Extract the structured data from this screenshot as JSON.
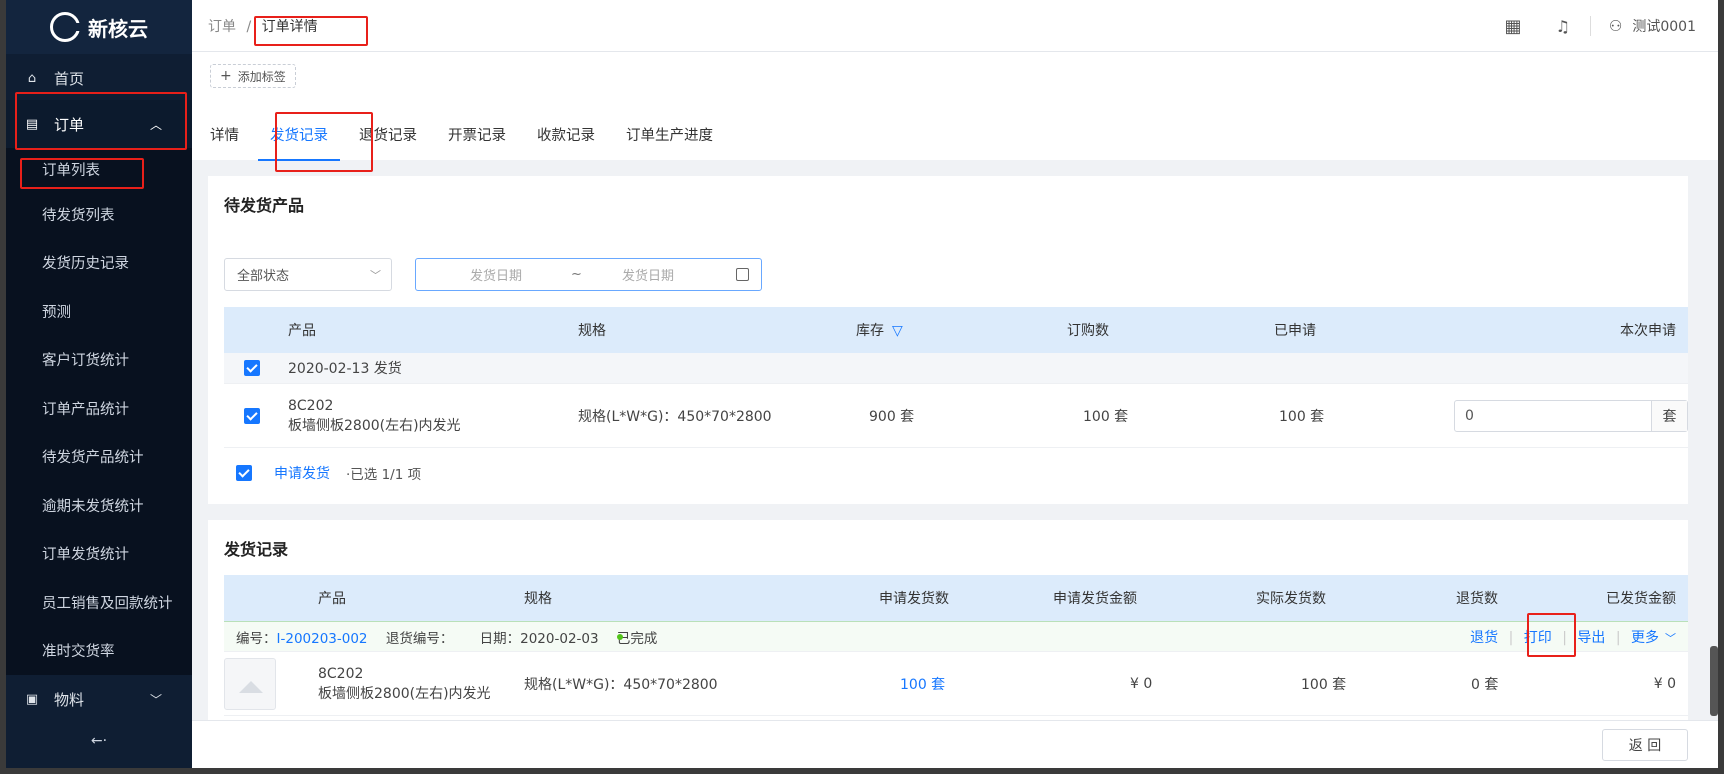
{
  "app": {
    "brand": "新核云"
  },
  "sidebar": {
    "home": "首页",
    "order": "订单",
    "order_sub": [
      "订单列表",
      "待发货列表",
      "发货历史记录",
      "预测",
      "客户订货统计",
      "订单产品统计",
      "待发货产品统计",
      "逾期未发货统计",
      "订单发货统计",
      "员工销售及回款统计",
      "准时交货率"
    ],
    "material": "物料",
    "collapse": "←·"
  },
  "topbar": {
    "crumb_root": "订单",
    "crumb_sep": "/",
    "crumb_current": "订单详情",
    "user": "测试0001"
  },
  "header": {
    "add_tag": "添加标签",
    "tabs": [
      "详情",
      "发货记录",
      "退货记录",
      "开票记录",
      "收款记录",
      "订单生产进度"
    ]
  },
  "pending": {
    "title": "待发货产品",
    "status_select": "全部状态",
    "date_start": "发货日期",
    "date_tilde": "~",
    "date_end": "发货日期",
    "columns": [
      "产品",
      "规格",
      "库存",
      "订购数",
      "已申请",
      "本次申请"
    ],
    "group_label": "2020-02-13 发货",
    "item": {
      "code": "8C202",
      "name": "板墙侧板2800(左右)内发光",
      "spec": "规格(L*W*G)：450*70*2800",
      "stock": "900 套",
      "ordered": "100 套",
      "applied": "100 套",
      "apply_value": "0",
      "unit": "套"
    },
    "apply_btn": "申请发货",
    "selected": "·已选 1/1 项"
  },
  "records": {
    "title": "发货记录",
    "columns": [
      "产品",
      "规格",
      "申请发货数",
      "申请发货金额",
      "实际发货数",
      "退货数",
      "已发货金额"
    ],
    "meta": {
      "no_label": "编号：",
      "no_value": "I-200203-002",
      "return_label": "退货编号：",
      "date_label": "日期：",
      "date_value": "2020-02-03",
      "status": "已完成"
    },
    "actions": {
      "return": "退货",
      "print": "打印",
      "export": "导出",
      "more": "更多"
    },
    "item": {
      "code": "8C202",
      "name": "板墙侧板2800(左右)内发光",
      "spec": "规格(L*W*G)：450*70*2800",
      "apply_qty": "100 套",
      "apply_amount": "¥ 0",
      "actual_qty": "100 套",
      "return_qty": "0 套",
      "shipped_amount": "¥ 0"
    }
  },
  "footer": {
    "back": "返 回"
  },
  "colors": {
    "accent": "#1677ff",
    "sidebar": "#0f1e33",
    "highlight": "#e8201a",
    "status_green": "#52c41a"
  }
}
